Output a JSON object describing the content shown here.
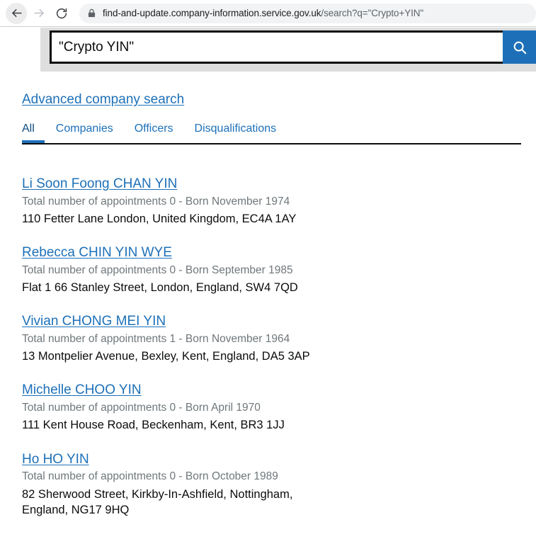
{
  "browser": {
    "back_label": "Back",
    "forward_label": "Forward",
    "reload_label": "Reload",
    "lock_label": "site-information-lock",
    "url_domain": "find-and-update.company-information.service.gov.uk",
    "url_path": "/search?q=\"Crypto+YIN\""
  },
  "search": {
    "value": "\"Crypto YIN\"",
    "placeholder": "Search the register",
    "submit_label": "Search",
    "accent_color": "#1d70b8"
  },
  "links": {
    "advanced_search": "Advanced company search"
  },
  "tabs": [
    {
      "label": "All",
      "active": true
    },
    {
      "label": "Companies",
      "active": false
    },
    {
      "label": "Officers",
      "active": false
    },
    {
      "label": "Disqualifications",
      "active": false
    }
  ],
  "results": [
    {
      "name": "Li Soon Foong CHAN YIN",
      "meta": "Total number of appointments 0 - Born November 1974",
      "address": "110 Fetter Lane London, United Kingdom, EC4A 1AY"
    },
    {
      "name": "Rebecca CHIN YIN WYE",
      "meta": "Total number of appointments 0 - Born September 1985",
      "address": "Flat 1 66 Stanley Street, London, England, SW4 7QD"
    },
    {
      "name": "Vivian CHONG MEI YIN",
      "meta": "Total number of appointments 1 - Born November 1964",
      "address": "13 Montpelier Avenue, Bexley, Kent, England, DA5 3AP"
    },
    {
      "name": "Michelle CHOO YIN",
      "meta": "Total number of appointments 0 - Born April 1970",
      "address": "111 Kent House Road, Beckenham, Kent, BR3 1JJ"
    },
    {
      "name": "Ho HO YIN",
      "meta": "Total number of appointments 0 - Born October 1989",
      "address": "82 Sherwood Street, Kirkby-In-Ashfield, Nottingham, England, NG17 9HQ"
    }
  ]
}
